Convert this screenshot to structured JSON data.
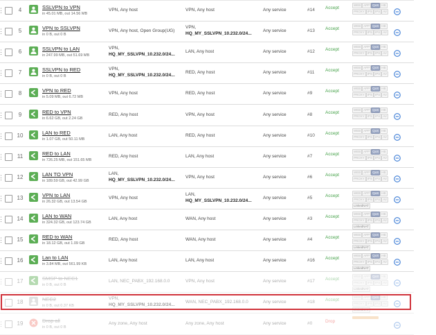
{
  "rules": [
    {
      "num": "4",
      "name": "SSLVPN to VPN",
      "usage": "in 45.01 MB, out 14.56 MB",
      "src": [
        "VPN, Any host"
      ],
      "dst": [
        "VPN, Any host"
      ],
      "service": "Any service",
      "id": "#14",
      "action": "Accept",
      "icon": "user",
      "nat": false
    },
    {
      "num": "5",
      "name": "VPN to SSLVPN",
      "usage": "in 0 B, out 0 B",
      "src": [
        "VPN, Any host, Open Group(UG)"
      ],
      "dst": [
        "VPN,",
        "HQ_MY_SSLVPN_10.232.0/24..."
      ],
      "service": "Any service",
      "id": "#13",
      "action": "Accept",
      "icon": "user",
      "nat": false
    },
    {
      "num": "6",
      "name": "SSLVPN to LAN",
      "usage": "in 247.99 MB, out 51.69 MB",
      "src": [
        "VPN,",
        "HQ_MY_SSLVPN_10.232.0/24..."
      ],
      "dst": [
        "LAN, Any host"
      ],
      "service": "Any service",
      "id": "#12",
      "action": "Accept",
      "icon": "user",
      "nat": false
    },
    {
      "num": "7",
      "name": "SSLVPN to RED",
      "usage": "in 0 B, out 0 B",
      "src": [
        "VPN,",
        "HQ_MY_SSLVPN_10.232.0/24..."
      ],
      "dst": [
        "RED, Any host"
      ],
      "service": "Any service",
      "id": "#11",
      "action": "Accept",
      "icon": "user",
      "nat": false
    },
    {
      "num": "8",
      "name": "VPN to RED",
      "usage": "in 5.09 MB, out 6.72 MB",
      "src": [
        "VPN, Any host"
      ],
      "dst": [
        "RED, Any host"
      ],
      "service": "Any service",
      "id": "#9",
      "action": "Accept",
      "icon": "net",
      "nat": false
    },
    {
      "num": "9",
      "name": "RED to VPN",
      "usage": "in 6.62 GB, out 2.24 GB",
      "src": [
        "RED, Any host"
      ],
      "dst": [
        "VPN, Any host"
      ],
      "service": "Any service",
      "id": "#8",
      "action": "Accept",
      "icon": "net",
      "nat": false
    },
    {
      "num": "10",
      "name": "LAN to RED",
      "usage": "in 1.07 GB, out 50.11 MB",
      "src": [
        "LAN, Any host"
      ],
      "dst": [
        "RED, Any host"
      ],
      "service": "Any service",
      "id": "#10",
      "action": "Accept",
      "icon": "net",
      "nat": false
    },
    {
      "num": "11",
      "name": "RED to LAN",
      "usage": "in 726.25 MB, out 151.65 MB",
      "src": [
        "RED, Any host"
      ],
      "dst": [
        "LAN, Any host"
      ],
      "service": "Any service",
      "id": "#7",
      "action": "Accept",
      "icon": "net",
      "nat": false
    },
    {
      "num": "12",
      "name": "LAN TO VPN",
      "usage": "in 189.59 GB, out 42.99 GB",
      "src": [
        "LAN,",
        "HQ_MY_SSLVPN_10.232.0/24..."
      ],
      "dst": [
        "VPN, Any host"
      ],
      "service": "Any service",
      "id": "#6",
      "action": "Accept",
      "icon": "net",
      "nat": false
    },
    {
      "num": "13",
      "name": "VPN to LAN",
      "usage": "in 26.32 GB, out 13.54 GB",
      "src": [
        "VPN, Any host"
      ],
      "dst": [
        "LAN,",
        "HQ_MY_SSLVPN_10.232.0/24..."
      ],
      "service": "Any service",
      "id": "#5",
      "action": "Accept",
      "icon": "net",
      "nat": true
    },
    {
      "num": "14",
      "name": "LAN to WAN",
      "usage": "in 324.32 GB, out 123.74 GB",
      "src": [
        "LAN, Any host"
      ],
      "dst": [
        "WAN, Any host"
      ],
      "service": "Any service",
      "id": "#3",
      "action": "Accept",
      "icon": "net",
      "nat": true
    },
    {
      "num": "15",
      "name": "RED to WAN",
      "usage": "in 18.12 GB, out 1.09 GB",
      "src": [
        "RED, Any host"
      ],
      "dst": [
        "WAN, Any host"
      ],
      "service": "Any service",
      "id": "#4",
      "action": "Accept",
      "icon": "net",
      "nat": true
    },
    {
      "num": "16",
      "name": "Lan to LAN",
      "usage": "in 3.84 MB, out 561.99 KB",
      "src": [
        "LAN, Any host"
      ],
      "dst": [
        "LAN, Any host"
      ],
      "service": "Any service",
      "id": "#16",
      "action": "Accept",
      "icon": "net",
      "nat": true
    },
    {
      "num": "17",
      "name": "SMSP to NEC1",
      "usage": "in 0 B, out 0 B",
      "src": [
        "LAN, NEC_PABX_192.168.0.0"
      ],
      "dst": [
        "VPN, Any host"
      ],
      "service": "Any service",
      "id": "#17",
      "action": "Accept",
      "icon": "net",
      "nat": true,
      "disabled": true
    },
    {
      "num": "18",
      "name": "NEC2",
      "usage": "in 0 B, out 0.37 KB",
      "src": [
        "VPN,",
        "HQ_MY_SSLVPN_10.232.0/24..."
      ],
      "dst": [
        "WAN, NEC_PABX_192.168.0.0"
      ],
      "service": "Any service",
      "id": "#18",
      "action": "Accept",
      "icon": "user",
      "nat": true,
      "disabled": true,
      "grey": true
    },
    {
      "num": "19",
      "name": "Drop all",
      "usage": "in 0 B, out 0 B",
      "src": [
        "Any zone, Any host"
      ],
      "dst": [
        "Any zone, Any host"
      ],
      "service": "Any service",
      "id": "#0",
      "action": "Drop",
      "icon": "drop",
      "nat": false,
      "disabled": true
    }
  ],
  "feature_tags": {
    "line1": [
      "WEB",
      "APP",
      "QoS",
      "HB"
    ],
    "line2": [
      "PROXY",
      "IPS",
      "IPS",
      "AV"
    ],
    "nat": "LinkedNAT"
  },
  "colors": {
    "accept": "#43a047",
    "drop": "#e53935",
    "icon": "#5cae55",
    "highlight": "#d0323a"
  }
}
